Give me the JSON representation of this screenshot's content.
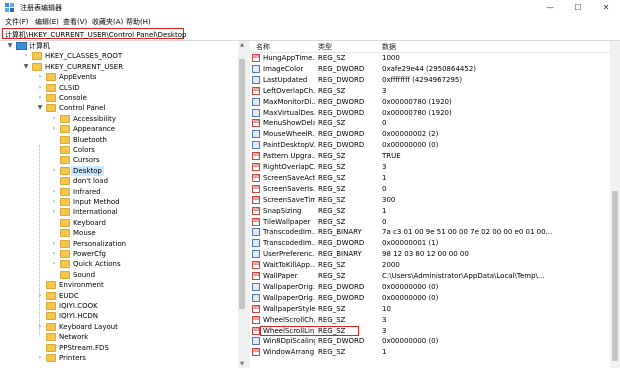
{
  "window": {
    "title": "注册表编辑器",
    "minimize": "—",
    "maximize": "☐",
    "close": "✕"
  },
  "menu": [
    "文件(F)",
    "编辑(E)",
    "查看(V)",
    "收藏夹(A)",
    "帮助(H)"
  ],
  "address": "计算机\\HKEY_CURRENT_USER\\Control Panel\\Desktop",
  "tree": [
    {
      "label": "计算机",
      "arrow": "▼",
      "type": "pc"
    },
    {
      "label": "HKEY_CLASSES_ROOT",
      "arrow": "›"
    },
    {
      "label": "HKEY_CURRENT_USER",
      "arrow": "▼"
    },
    {
      "label": "AppEvents",
      "arrow": "›"
    },
    {
      "label": "CLSID",
      "arrow": "›"
    },
    {
      "label": "Console",
      "arrow": "›"
    },
    {
      "label": "Control Panel",
      "arrow": "▼"
    },
    {
      "label": "Accessibility",
      "arrow": "›"
    },
    {
      "label": "Appearance",
      "arrow": "›"
    },
    {
      "label": "Bluetooth",
      "arrow": ""
    },
    {
      "label": "Colors",
      "arrow": ""
    },
    {
      "label": "Cursors",
      "arrow": ""
    },
    {
      "label": "Desktop",
      "arrow": "›",
      "selected": true
    },
    {
      "label": "don't load",
      "arrow": ""
    },
    {
      "label": "Infrared",
      "arrow": "›"
    },
    {
      "label": "Input Method",
      "arrow": "›"
    },
    {
      "label": "International",
      "arrow": "›"
    },
    {
      "label": "Keyboard",
      "arrow": ""
    },
    {
      "label": "Mouse",
      "arrow": ""
    },
    {
      "label": "Personalization",
      "arrow": "›"
    },
    {
      "label": "PowerCfg",
      "arrow": "›"
    },
    {
      "label": "Quick Actions",
      "arrow": "›"
    },
    {
      "label": "Sound",
      "arrow": ""
    },
    {
      "label": "Environment",
      "arrow": ""
    },
    {
      "label": "EUDC",
      "arrow": "›"
    },
    {
      "label": "IQIYI.COOK",
      "arrow": ""
    },
    {
      "label": "IQIYI.HCDN",
      "arrow": ""
    },
    {
      "label": "Keyboard Layout",
      "arrow": "›"
    },
    {
      "label": "Network",
      "arrow": ""
    },
    {
      "label": "PPStream.FDS",
      "arrow": ""
    },
    {
      "label": "Printers",
      "arrow": "›"
    }
  ],
  "columns": {
    "name": "名称",
    "type": "类型",
    "data": "数据"
  },
  "values": [
    {
      "name": "HungAppTime...",
      "type": "REG_SZ",
      "data": "1000",
      "icon": "sz"
    },
    {
      "name": "ImageColor",
      "type": "REG_DWORD",
      "data": "0xafe29e44 (2950864452)",
      "icon": "bin"
    },
    {
      "name": "LastUpdated",
      "type": "REG_DWORD",
      "data": "0xffffffff (4294967295)",
      "icon": "bin"
    },
    {
      "name": "LeftOverlapCh...",
      "type": "REG_SZ",
      "data": "3",
      "icon": "sz"
    },
    {
      "name": "MaxMonitorDi...",
      "type": "REG_DWORD",
      "data": "0x00000780 (1920)",
      "icon": "bin"
    },
    {
      "name": "MaxVirtualDes...",
      "type": "REG_DWORD",
      "data": "0x00000780 (1920)",
      "icon": "bin"
    },
    {
      "name": "MenuShowDelay",
      "type": "REG_SZ",
      "data": "0",
      "icon": "sz"
    },
    {
      "name": "MouseWheelR...",
      "type": "REG_DWORD",
      "data": "0x00000002 (2)",
      "icon": "bin"
    },
    {
      "name": "PaintDesktopV...",
      "type": "REG_DWORD",
      "data": "0x00000000 (0)",
      "icon": "bin"
    },
    {
      "name": "Pattern Upgra...",
      "type": "REG_SZ",
      "data": "TRUE",
      "icon": "sz"
    },
    {
      "name": "RightOverlapC...",
      "type": "REG_SZ",
      "data": "3",
      "icon": "sz"
    },
    {
      "name": "ScreenSaveActi...",
      "type": "REG_SZ",
      "data": "1",
      "icon": "sz"
    },
    {
      "name": "ScreenSaverIs...",
      "type": "REG_SZ",
      "data": "0",
      "icon": "sz"
    },
    {
      "name": "ScreenSaveTim...",
      "type": "REG_SZ",
      "data": "300",
      "icon": "sz"
    },
    {
      "name": "SnapSizing",
      "type": "REG_SZ",
      "data": "1",
      "icon": "sz"
    },
    {
      "name": "TileWallpaper",
      "type": "REG_SZ",
      "data": "0",
      "icon": "sz"
    },
    {
      "name": "TranscodedIm...",
      "type": "REG_BINARY",
      "data": "7a c3 01 00 9e 51 00 00 7e 02 00 00 e0 01 00...",
      "icon": "bin"
    },
    {
      "name": "TranscodedIm...",
      "type": "REG_DWORD",
      "data": "0x00000001 (1)",
      "icon": "bin"
    },
    {
      "name": "UserPreferenc...",
      "type": "REG_BINARY",
      "data": "98 12 03 80 12 00 00 00",
      "icon": "bin"
    },
    {
      "name": "WaitToKillApp...",
      "type": "REG_SZ",
      "data": "2000",
      "icon": "sz"
    },
    {
      "name": "WallPaper",
      "type": "REG_SZ",
      "data": "C:\\Users\\Administrator\\AppData\\Local\\Temp\\...",
      "icon": "sz"
    },
    {
      "name": "WallpaperOrig...",
      "type": "REG_DWORD",
      "data": "0x00000000 (0)",
      "icon": "bin"
    },
    {
      "name": "WallpaperOrig...",
      "type": "REG_DWORD",
      "data": "0x00000000 (0)",
      "icon": "bin"
    },
    {
      "name": "WallpaperStyle",
      "type": "REG_SZ",
      "data": "10",
      "icon": "sz"
    },
    {
      "name": "WheelScrollCh...",
      "type": "REG_SZ",
      "data": "3",
      "icon": "sz"
    },
    {
      "name": "WheelScrollLin...",
      "type": "REG_SZ",
      "data": "3",
      "icon": "sz",
      "highlighted": true
    },
    {
      "name": "Win8DpiScaling",
      "type": "REG_DWORD",
      "data": "0x00000000 (0)",
      "icon": "bin"
    },
    {
      "name": "WindowArrang...",
      "type": "REG_SZ",
      "data": "1",
      "icon": "sz"
    }
  ]
}
